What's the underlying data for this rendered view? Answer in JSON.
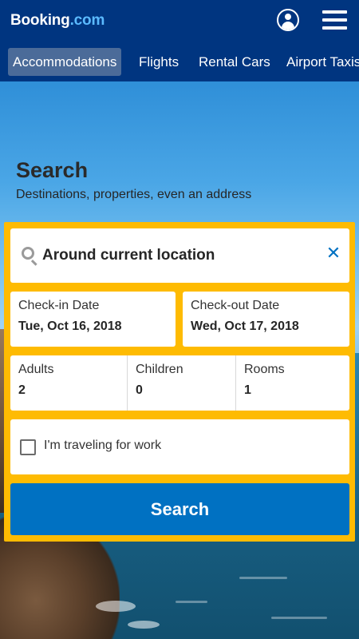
{
  "header": {
    "logo_main": "Booking",
    "logo_suffix": ".com",
    "account_icon": "user-circle-icon",
    "menu_icon": "hamburger-menu-icon"
  },
  "nav": {
    "items": [
      {
        "label": "Accommodations",
        "active": true
      },
      {
        "label": "Flights",
        "active": false
      },
      {
        "label": "Rental Cars",
        "active": false
      },
      {
        "label": "Airport Taxis",
        "active": false
      }
    ]
  },
  "hero": {
    "title": "Search",
    "subtitle": "Destinations, properties, even an address"
  },
  "search": {
    "destination_icon": "search-icon",
    "destination_value": "Around current location",
    "clear_icon": "close-icon",
    "checkin_label": "Check-in Date",
    "checkin_value": "Tue, Oct 16, 2018",
    "checkout_label": "Check-out Date",
    "checkout_value": "Wed, Oct 17, 2018",
    "guests": [
      {
        "label": "Adults",
        "value": "2"
      },
      {
        "label": "Children",
        "value": "0"
      },
      {
        "label": "Rooms",
        "value": "1"
      }
    ],
    "work_label": "I'm traveling for work",
    "work_checked": false,
    "button_label": "Search"
  },
  "colors": {
    "header_bg": "#003580",
    "accent_yellow": "#febb02",
    "button_blue": "#0071c2",
    "logo_suffix": "#5bbaff"
  }
}
